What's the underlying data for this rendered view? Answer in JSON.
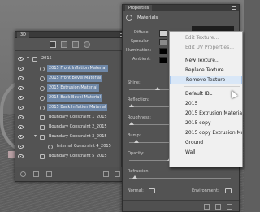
{
  "panel3d": {
    "tab_label": "3D",
    "layers": [
      {
        "label": "2015",
        "selected": false
      },
      {
        "label": "2015 Front Inflation Material",
        "selected": true
      },
      {
        "label": "2015 Front Bevel Material",
        "selected": true
      },
      {
        "label": "2015 Extrusion Material",
        "selected": true
      },
      {
        "label": "2015 Back Bevel Material",
        "selected": true
      },
      {
        "label": "2015 Back Inflation Material",
        "selected": true
      },
      {
        "label": "Boundary Constraint 1_2015",
        "selected": false
      },
      {
        "label": "Boundary Constraint 2_2015",
        "selected": false
      },
      {
        "label": "Boundary Constraint 3_2015",
        "selected": false
      },
      {
        "label": "Internal Constraint 4_2015",
        "selected": false
      },
      {
        "label": "Boundary Constraint 5_2015",
        "selected": false
      }
    ]
  },
  "properties": {
    "tab_label": "Properties",
    "section_title": "Materials",
    "labels": {
      "diffuse": "Diffuse:",
      "specular": "Specular:",
      "illumination": "Illumination:",
      "ambient": "Ambient:",
      "shine": "Shine:",
      "reflection": "Reflection:",
      "roughness": "Roughness:",
      "bump": "Bump:",
      "opacity": "Opacity:",
      "refraction": "Refraction:",
      "normal": "Normal:",
      "environment": "Environment:"
    },
    "colors": {
      "diffuse": "#cfcfcf",
      "specular": "#8a8a8a",
      "illumination": "#000000",
      "ambient": "#000000"
    }
  },
  "context_menu": {
    "items": [
      {
        "label": "Edit Texture...",
        "disabled": true
      },
      {
        "label": "Edit UV Properties...",
        "disabled": true
      },
      {
        "label": "New Texture...",
        "disabled": false
      },
      {
        "label": "Replace Texture...",
        "disabled": false
      },
      {
        "label": "Remove Texture",
        "disabled": false,
        "hover": true
      },
      {
        "label": "Default IBL",
        "disabled": false
      },
      {
        "label": "2015",
        "disabled": false
      },
      {
        "label": "2015 Extrusion Material - ...",
        "disabled": false
      },
      {
        "label": "2015 copy",
        "disabled": false
      },
      {
        "label": "2015 copy Extrusion Mate...",
        "disabled": false
      },
      {
        "label": "Ground",
        "disabled": false
      },
      {
        "label": "Wall",
        "disabled": false
      }
    ]
  }
}
